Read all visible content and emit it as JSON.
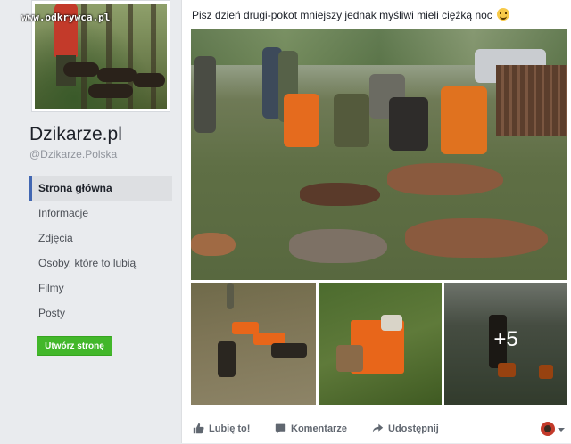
{
  "watermark": "www.odkrywca.pl",
  "page": {
    "name": "Dzikarze.pl",
    "handle": "@Dzikarze.Polska"
  },
  "nav": {
    "items": [
      {
        "label": "Strona główna",
        "active": true
      },
      {
        "label": "Informacje",
        "active": false
      },
      {
        "label": "Zdjęcia",
        "active": false
      },
      {
        "label": "Osoby, które to lubią",
        "active": false
      },
      {
        "label": "Filmy",
        "active": false
      },
      {
        "label": "Posty",
        "active": false
      }
    ],
    "create_label": "Utwórz stronę"
  },
  "post": {
    "text": "Pisz dzień drugi-pokot mniejszy jednak myśliwi mieli ciężką noc",
    "more_photos": "+5",
    "actions": {
      "like": "Lubię to!",
      "comment": "Komentarze",
      "share": "Udostępnij"
    }
  },
  "colors": {
    "accent": "#4267b2",
    "create_button": "#42b72a",
    "background": "#e9ebee"
  }
}
